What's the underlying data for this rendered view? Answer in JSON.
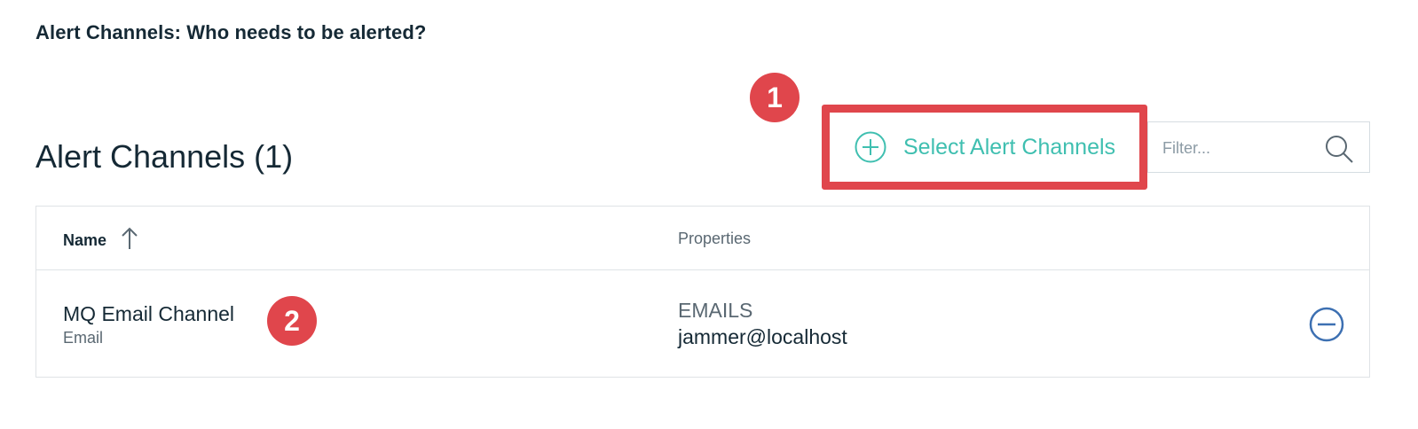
{
  "section": {
    "heading": "Alert Channels: Who needs to be alerted?"
  },
  "table": {
    "title": "Alert Channels (1)",
    "columns": {
      "name": "Name",
      "properties": "Properties"
    },
    "rows": [
      {
        "name": "MQ Email Channel",
        "type": "Email",
        "property_key": "EMAILS",
        "property_value": "jammer@localhost"
      }
    ]
  },
  "toolbar": {
    "select_label": "Select Alert Channels",
    "filter_placeholder": "Filter..."
  },
  "annotations": {
    "badge_1": "1",
    "badge_2": "2"
  },
  "icons": {
    "add": "plus-circle-icon",
    "search": "search-icon",
    "sort": "arrow-up-icon",
    "remove": "minus-circle-icon"
  },
  "colors": {
    "accent_teal": "#3fbfb0",
    "annotation_red": "#e0464c",
    "remove_blue": "#3d70b2"
  }
}
